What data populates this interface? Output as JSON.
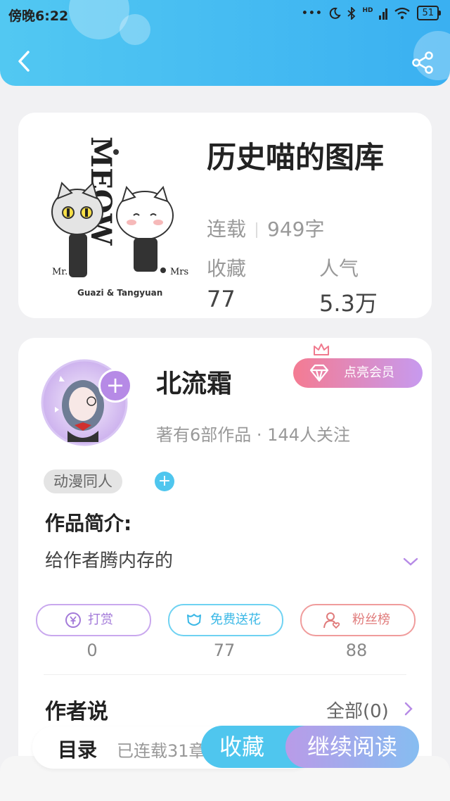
{
  "status_bar": {
    "time": "傍晚6:22",
    "dots": "•••",
    "hd": "HD",
    "battery": "51"
  },
  "colors": {
    "header_start": "#52c8f2",
    "header_end": "#3ab0f1",
    "vip_start": "#f47b92",
    "vip_end": "#c79aef",
    "accent_blue": "#4fc6ee",
    "accent_purple": "#b68ae6"
  },
  "icons": {
    "back": "chevron-left-icon",
    "share": "share-icon",
    "moon": "moon-icon",
    "bluetooth": "bluetooth-icon",
    "wifi": "wifi-icon",
    "signal": "signal-icon"
  },
  "book": {
    "title": "历史喵的图库",
    "status": "连载",
    "word_count": "949字",
    "favorites_label": "收藏",
    "favorites_value": "77",
    "popularity_label": "人气",
    "popularity_value": "5.3万",
    "cover_text": {
      "logo": "MEOW",
      "left": "Mr.",
      "right": "Mrs",
      "caption": "Guazi & Tangyuan"
    }
  },
  "author": {
    "name": "北流霜",
    "vip_button": "点亮会员",
    "meta": "著有6部作品 · 144人关注",
    "tag": "动漫同人",
    "tag_add": "+",
    "avatar_add": "+"
  },
  "intro": {
    "label": "作品简介:",
    "text": "给作者腾内存的"
  },
  "actions": [
    {
      "label": "打赏",
      "count": "0",
      "icon": "yuan-icon",
      "color": "#b68ae6"
    },
    {
      "label": "免费送花",
      "count": "77",
      "icon": "flower-icon",
      "color": "#4fc6ee"
    },
    {
      "label": "粉丝榜",
      "count": "88",
      "icon": "fan-rank-icon",
      "color": "#ef8a8a"
    }
  ],
  "author_says": {
    "label": "作者说",
    "all": "全部(0)"
  },
  "bottom": {
    "toc": "目录",
    "toc_status": "已连载31章",
    "favorite": "收藏",
    "continue": "继续阅读"
  }
}
